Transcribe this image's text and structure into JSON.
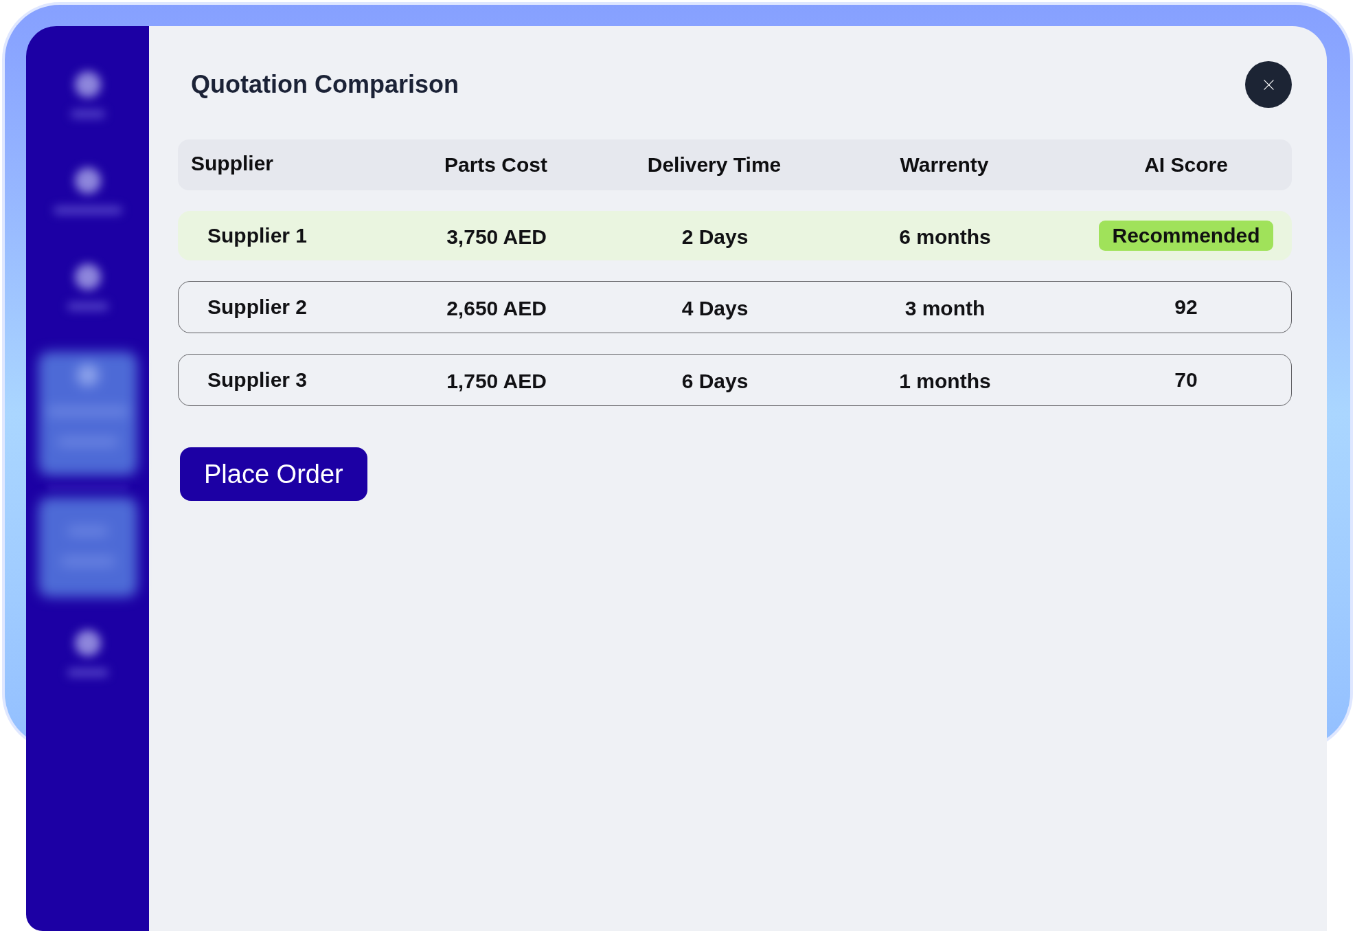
{
  "dialog": {
    "title": "Quotation Comparison"
  },
  "table": {
    "columns": [
      "Supplier",
      "Parts Cost",
      "Delivery Time",
      "Warrenty",
      "AI Score"
    ],
    "rows": [
      {
        "cells": [
          "Supplier 1",
          "3,750 AED",
          "2 Days",
          "6 months",
          "Recommended"
        ],
        "recommended": true
      },
      {
        "cells": [
          "Supplier 2",
          "2,650 AED",
          "4 Days",
          "3 month",
          "92"
        ],
        "recommended": false
      },
      {
        "cells": [
          "Supplier 3",
          "1,750 AED",
          "6 Days",
          "1 months",
          "70"
        ],
        "recommended": false
      }
    ]
  },
  "actions": [
    {
      "label": "Place Order"
    }
  ]
}
